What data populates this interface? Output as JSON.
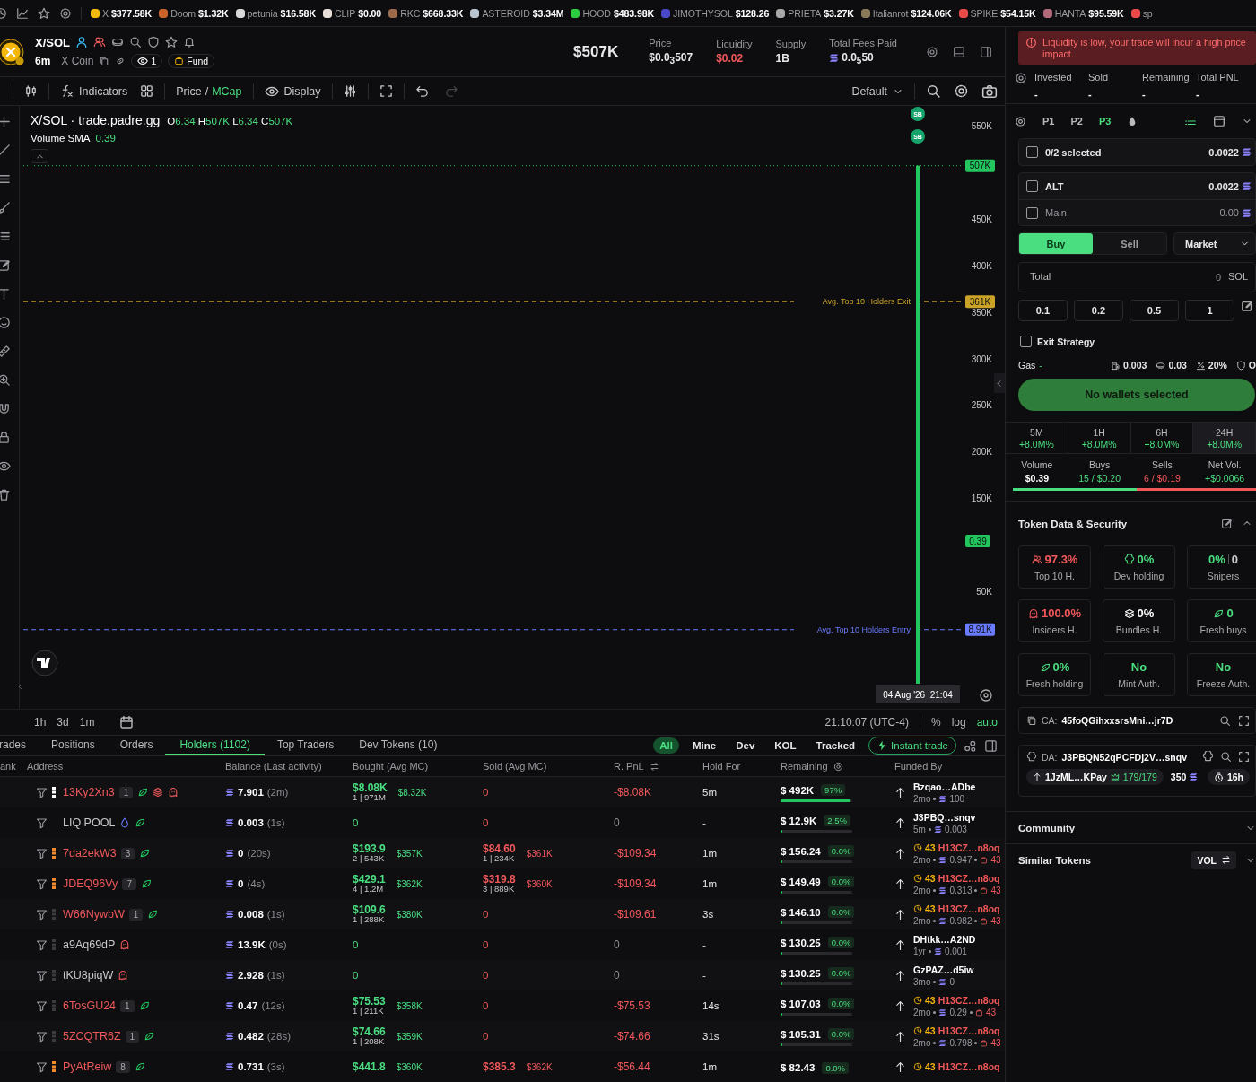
{
  "ticker": {
    "items": [
      {
        "name": "X",
        "value": "$377.58K",
        "color": "#f0b90b"
      },
      {
        "name": "Doom",
        "value": "$1.32K",
        "color": "#c8642a"
      },
      {
        "name": "petunia",
        "value": "$16.58K",
        "color": "#d8d8d8"
      },
      {
        "name": "CLIP",
        "value": "$0.00",
        "color": "#e8e0d8"
      },
      {
        "name": "RKC",
        "value": "$668.33K",
        "color": "#9a6a4a"
      },
      {
        "name": "ASTEROID",
        "value": "$3.34M",
        "color": "#b8c4d0"
      },
      {
        "name": "HOOD",
        "value": "$483.98K",
        "color": "#2ecc40"
      },
      {
        "name": "JIMOTHYSOL",
        "value": "$128.26",
        "color": "#4a4ac8"
      },
      {
        "name": "PRIETA",
        "value": "$3.27K",
        "color": "#a8a8a8"
      },
      {
        "name": "Italianrot",
        "value": "$124.06K",
        "color": "#8a7a5a"
      },
      {
        "name": "SPIKE",
        "value": "$54.15K",
        "color": "#e84a4a"
      },
      {
        "name": "HANTA",
        "value": "$95.59K",
        "color": "#b06a7a"
      },
      {
        "name": "sp",
        "color": "#e84a4a"
      }
    ]
  },
  "token": {
    "pair": "X/SOL",
    "age": "6m",
    "name": "X Coin",
    "views": "1",
    "fund": "Fund",
    "market_cap": "$507K",
    "stats": [
      {
        "label": "Price",
        "value": "$0.0$_{3}$507",
        "kind": "plain"
      },
      {
        "label": "Liquidity",
        "value": "$0.02",
        "kind": "negative"
      },
      {
        "label": "Supply",
        "value": "1B",
        "kind": "plain"
      },
      {
        "label": "Total Fees Paid",
        "value": "0.0$_{5}$50",
        "kind": "sol"
      }
    ]
  },
  "chart_toolbar": {
    "indicators": "Indicators",
    "price_mode": [
      {
        "label": "Price",
        "selected": false
      },
      {
        "label": "MCap",
        "selected": true
      }
    ],
    "separator": "/",
    "display": "Display",
    "layout": "Default"
  },
  "chart": {
    "legend": {
      "title": "X/SOL · trade.padre.gg",
      "ohlc": [
        {
          "key": "O",
          "value": "6.34"
        },
        {
          "key": "H",
          "value": "507K"
        },
        {
          "key": "L",
          "value": "6.34"
        },
        {
          "key": "C",
          "value": "507K"
        }
      ],
      "volume_label": "Volume SMA",
      "volume_value": "0.39"
    },
    "markers": [
      "SB",
      "SB"
    ],
    "volume_marker": "0.39",
    "chart_data": {
      "type": "bar",
      "categories": [
        "04 Aug '26  21:04"
      ],
      "values": [
        507000
      ],
      "yticks": [
        {
          "value": 550000,
          "label": "550K"
        },
        {
          "value": 450000,
          "label": "450K"
        },
        {
          "value": 400000,
          "label": "400K"
        },
        {
          "value": 350000,
          "label": "350K"
        },
        {
          "value": 300000,
          "label": "300K"
        },
        {
          "value": 250000,
          "label": "250K"
        },
        {
          "value": 200000,
          "label": "200K"
        },
        {
          "value": 150000,
          "label": "150K"
        },
        {
          "value": 50000,
          "label": "50K"
        }
      ],
      "ylim": [
        0,
        550000
      ],
      "ref_lines": [
        {
          "axis": "y",
          "value": 507000,
          "color": "#22c55e"
        },
        {
          "axis": "y",
          "value": 361000,
          "label": "Avg. Top 10 Holders Exit",
          "color": "#c9a227"
        },
        {
          "axis": "y",
          "value": 8910,
          "label": "Avg. Top 10 Holders Entry",
          "color": "#6b7bff"
        }
      ],
      "annotations": [
        "507K",
        "361K",
        "8.91K"
      ]
    }
  },
  "chart_footer": {
    "ranges": [
      "1h",
      "3d",
      "1m"
    ],
    "clock": "21:10:07 (UTC-4)",
    "scales": [
      {
        "label": "%",
        "selected": false
      },
      {
        "label": "log",
        "selected": false
      },
      {
        "label": "auto",
        "selected": true
      }
    ]
  },
  "table": {
    "tabs": [
      {
        "label": "rades",
        "selected": false
      },
      {
        "label": "Positions",
        "selected": false
      },
      {
        "label": "Orders",
        "selected": false
      },
      {
        "label": "Holders (1102)",
        "selected": true
      },
      {
        "label": "Top Traders",
        "selected": false
      },
      {
        "label": "Dev Tokens (10)",
        "selected": false
      }
    ],
    "filters": [
      {
        "label": "All",
        "selected": true
      },
      {
        "label": "Mine",
        "selected": false
      },
      {
        "label": "Dev",
        "selected": false
      },
      {
        "label": "KOL",
        "selected": false
      },
      {
        "label": "Tracked",
        "selected": false
      }
    ],
    "instant_trade": "Instant trade",
    "columns": [
      "ank",
      "Address",
      "Balance (Last activity)",
      "Bought (Avg MC)",
      "Sold (Avg MC)",
      "R. PnL",
      "Hold For",
      "Remaining",
      "Funded By"
    ],
    "rows": [
      {
        "address": "13Ky2Xn3",
        "flagged": true,
        "color": "#ffffff",
        "count": "1",
        "tags": [
          {
            "kind": "fresh"
          },
          {
            "kind": "bundle"
          },
          {
            "kind": "insider"
          }
        ],
        "balance": "7.901",
        "activity": "(2m)",
        "bought": {
          "amount": "$8.08K",
          "detail": "1 | 971M",
          "avg_mc": "$8.32K"
        },
        "sold": {
          "amount": "0"
        },
        "pnl": {
          "value": "-$8.08K",
          "negative": true
        },
        "hold": "5m",
        "remaining": "$ 492K",
        "share": "97%",
        "level": 0.97,
        "funder": {
          "kind": "wallet",
          "name": "Bzqao…ADbe",
          "age": "2mo",
          "amount": "100"
        }
      },
      {
        "address": "LIQ POOL",
        "flagged": false,
        "tags": [
          {
            "kind": "pool"
          },
          {
            "kind": "fresh"
          }
        ],
        "balance": "0.003",
        "activity": "(1s)",
        "bought": {
          "amount": "0"
        },
        "sold": {
          "amount": "0"
        },
        "pnl": {
          "value": "0",
          "negative": false
        },
        "hold": "-",
        "remaining": "$ 12.9K",
        "share": "2.5%",
        "level": 0.025,
        "funder": {
          "kind": "wallet",
          "name": "J3PBQ…snqv",
          "age": "5m",
          "amount": "0.003"
        }
      },
      {
        "address": "7da2ekW3",
        "flagged": true,
        "color": "#f08c2e",
        "count": "3",
        "tags": [
          {
            "kind": "fresh"
          }
        ],
        "balance": "0",
        "activity": "(20s)",
        "bought": {
          "amount": "$193.9",
          "detail": "2 | 543K",
          "avg_mc": "$357K"
        },
        "sold": {
          "amount": "$84.60",
          "detail": "1 | 234K",
          "avg_mc": "$361K"
        },
        "pnl": {
          "value": "-$109.34",
          "negative": true
        },
        "hold": "1m",
        "remaining": "$ 156.24",
        "share": "0.0%",
        "level": 0.004,
        "funder": {
          "kind": "cluster",
          "count": "43",
          "name": "H13CZ…n8oq",
          "age": "2mo",
          "amount": "0.947",
          "badge": "43"
        }
      },
      {
        "address": "JDEQ96Vy",
        "flagged": true,
        "color": "#f08c2e",
        "count": "7",
        "tags": [
          {
            "kind": "fresh"
          }
        ],
        "balance": "0",
        "activity": "(4s)",
        "bought": {
          "amount": "$429.1",
          "detail": "4 | 1.2M",
          "avg_mc": "$362K"
        },
        "sold": {
          "amount": "$319.8",
          "detail": "3 | 889K",
          "avg_mc": "$360K"
        },
        "pnl": {
          "value": "-$109.34",
          "negative": true
        },
        "hold": "1m",
        "remaining": "$ 149.49",
        "share": "0.0%",
        "level": 0.004,
        "funder": {
          "kind": "cluster",
          "count": "43",
          "name": "H13CZ…n8oq",
          "age": "2mo",
          "amount": "0.313",
          "badge": "43"
        }
      },
      {
        "address": "W66NywbW",
        "flagged": true,
        "color": "#3a3a3f",
        "count": "1",
        "tags": [
          {
            "kind": "fresh"
          }
        ],
        "balance": "0.008",
        "activity": "(1s)",
        "bought": {
          "amount": "$109.6",
          "detail": "1 | 288K",
          "avg_mc": "$380K"
        },
        "sold": {
          "amount": "0"
        },
        "pnl": {
          "value": "-$109.61",
          "negative": true
        },
        "hold": "3s",
        "remaining": "$ 146.10",
        "share": "0.0%",
        "level": 0.004,
        "funder": {
          "kind": "cluster",
          "count": "43",
          "name": "H13CZ…n8oq",
          "age": "2mo",
          "amount": "0.982",
          "badge": "43"
        }
      },
      {
        "address": "a9Aq69dP",
        "flagged": false,
        "color": "#3a3a3f",
        "tags": [
          {
            "kind": "insider"
          }
        ],
        "balance": "13.9K",
        "activity": "(0s)",
        "bought": {
          "amount": "0"
        },
        "sold": {
          "amount": "0"
        },
        "pnl": {
          "value": "0",
          "negative": false
        },
        "hold": "-",
        "remaining": "$ 130.25",
        "share": "0.0%",
        "level": 0.004,
        "funder": {
          "kind": "wallet",
          "name": "DHtkk…A2ND",
          "age": "1yr",
          "amount": "0.001"
        }
      },
      {
        "address": "tKU8piqW",
        "flagged": false,
        "color": "#3a3a3f",
        "tags": [
          {
            "kind": "insider"
          }
        ],
        "balance": "2.928",
        "activity": "(1s)",
        "bought": {
          "amount": "0"
        },
        "sold": {
          "amount": "0"
        },
        "pnl": {
          "value": "0",
          "negative": false
        },
        "hold": "-",
        "remaining": "$ 130.25",
        "share": "0.0%",
        "level": 0.004,
        "funder": {
          "kind": "wallet",
          "name": "GzPAZ…d5iw",
          "age": "3mo",
          "amount": "0"
        }
      },
      {
        "address": "6TosGU24",
        "flagged": true,
        "color": "#3a3a3f",
        "count": "1",
        "tags": [
          {
            "kind": "fresh"
          }
        ],
        "balance": "0.47",
        "activity": "(12s)",
        "bought": {
          "amount": "$75.53",
          "detail": "1 | 211K",
          "avg_mc": "$358K"
        },
        "sold": {
          "amount": "0"
        },
        "pnl": {
          "value": "-$75.53",
          "negative": true
        },
        "hold": "14s",
        "remaining": "$ 107.03",
        "share": "0.0%",
        "level": 0.004,
        "funder": {
          "kind": "cluster",
          "count": "43",
          "name": "H13CZ…n8oq",
          "age": "2mo",
          "amount": "0.29",
          "badge": "43"
        }
      },
      {
        "address": "5ZCQTR6Z",
        "flagged": true,
        "color": "#3a3a3f",
        "count": "1",
        "tags": [
          {
            "kind": "fresh"
          }
        ],
        "balance": "0.482",
        "activity": "(28s)",
        "bought": {
          "amount": "$74.66",
          "detail": "1 | 208K",
          "avg_mc": "$359K"
        },
        "sold": {
          "amount": "0"
        },
        "pnl": {
          "value": "-$74.66",
          "negative": true
        },
        "hold": "31s",
        "remaining": "$ 105.31",
        "share": "0.0%",
        "level": 0.004,
        "funder": {
          "kind": "cluster",
          "count": "43",
          "name": "H13CZ…n8oq",
          "age": "2mo",
          "amount": "0.798",
          "badge": "43"
        }
      },
      {
        "address": "PyAtReiw",
        "flagged": true,
        "color": "#f08c2e",
        "count": "8",
        "tags": [
          {
            "kind": "fresh"
          }
        ],
        "balance": "0.731",
        "activity": "(3s)",
        "bought": {
          "amount": "$441.8",
          "avg_mc": "$360K"
        },
        "sold": {
          "amount": "$385.3",
          "avg_mc": "$362K"
        },
        "pnl": {
          "value": "-$56.44",
          "negative": true
        },
        "hold": "1m",
        "remaining": "$ 82.43",
        "share": "0.0%",
        "funder": {
          "kind": "cluster",
          "count": "43",
          "name": "H13CZ…n8oq"
        }
      }
    ]
  },
  "side": {
    "alert": "Liquidity is low, your trade will incur a high price impact.",
    "position": [
      {
        "label": "Invested",
        "value": "-"
      },
      {
        "label": "Sold",
        "value": "-"
      },
      {
        "label": "Remaining",
        "value": "-"
      },
      {
        "label": "Total PNL",
        "value": "-"
      }
    ],
    "presets": [
      {
        "label": "P1",
        "selected": false
      },
      {
        "label": "P2",
        "selected": false
      },
      {
        "label": "P3",
        "selected": true
      }
    ],
    "wallet_summary": {
      "label": "0/2 selected",
      "balance": "0.0022",
      "checked": false
    },
    "wallets": [
      {
        "name": "ALT",
        "balance": "0.0022",
        "checked": false,
        "dimmed": false
      },
      {
        "name": "Main",
        "balance": "0.00",
        "checked": false,
        "dimmed": true
      }
    ],
    "sides": [
      {
        "label": "Buy",
        "selected": true
      },
      {
        "label": "Sell",
        "selected": false
      }
    ],
    "order_type": "Market",
    "total": {
      "label": "Total",
      "placeholder": "0",
      "unit": "SOL"
    },
    "amounts": [
      "0.1",
      "0.2",
      "0.5",
      "1"
    ],
    "exit_strategy": {
      "label": "Exit Strategy",
      "checked": false
    },
    "gas": {
      "label": "Gas",
      "value": "-",
      "fees": [
        {
          "kind": "priority",
          "value": "0.003"
        },
        {
          "kind": "tip",
          "value": "0.03"
        },
        {
          "kind": "slippage",
          "value": "20%"
        },
        {
          "kind": "protection",
          "value": "O"
        }
      ]
    },
    "submit": "No wallets selected",
    "periods": [
      {
        "label": "5M",
        "change": "+8.0M%",
        "selected": false
      },
      {
        "label": "1H",
        "change": "+8.0M%",
        "selected": false
      },
      {
        "label": "6H",
        "change": "+8.0M%",
        "selected": false
      },
      {
        "label": "24H",
        "change": "+8.0M%",
        "selected": true
      }
    ],
    "flow": [
      {
        "label": "Volume",
        "value": "$0.39",
        "kind": "plain"
      },
      {
        "label": "Buys",
        "value": "15 / $0.20",
        "kind": "buy"
      },
      {
        "label": "Sells",
        "value": "6 / $0.19",
        "kind": "sell"
      },
      {
        "label": "Net Vol.",
        "value": "+$0.0066",
        "kind": "buy"
      }
    ],
    "buy_ratio": {
      "level": 0.51
    },
    "security": {
      "title": "Token Data & Security",
      "cards": [
        {
          "value": "97.3%",
          "label": "Top 10 H.",
          "color": "#f0585a",
          "kind": "holders"
        },
        {
          "value": "0%",
          "label": "Dev holding",
          "color": "#4ade80",
          "kind": "dev"
        },
        {
          "value": "0%",
          "extra": "0",
          "label": "Snipers",
          "color": "#4ade80",
          "kind": "snipers"
        },
        {
          "value": "100.0%",
          "label": "Insiders H.",
          "color": "#f0585a",
          "kind": "insiders"
        },
        {
          "value": "0%",
          "label": "Bundles H.",
          "color": "#ffffff",
          "kind": "bundles"
        },
        {
          "value": "0",
          "label": "Fresh buys",
          "color": "#4ade80",
          "kind": "fresh"
        },
        {
          "value": "0%",
          "label": "Fresh holding",
          "color": "#4ade80",
          "kind": "fresh"
        },
        {
          "value": "No",
          "label": "Mint Auth.",
          "color": "#4ade80",
          "kind": "authority"
        },
        {
          "value": "No",
          "label": "Freeze Auth.",
          "color": "#4ade80",
          "kind": "authority"
        }
      ]
    },
    "contract": {
      "label": "CA:",
      "value": "45foQGihxxsrsMni…jr7D"
    },
    "deployer": {
      "label": "DA:",
      "value": "J3PBQN52qPCFDj2V…snqv",
      "funder": "1JzML…KPay",
      "migrations": "179/179",
      "balance": "350",
      "age": "16h"
    },
    "sections": [
      {
        "title": "Community"
      },
      {
        "title": "Similar Tokens",
        "sort": "VOL"
      }
    ]
  }
}
